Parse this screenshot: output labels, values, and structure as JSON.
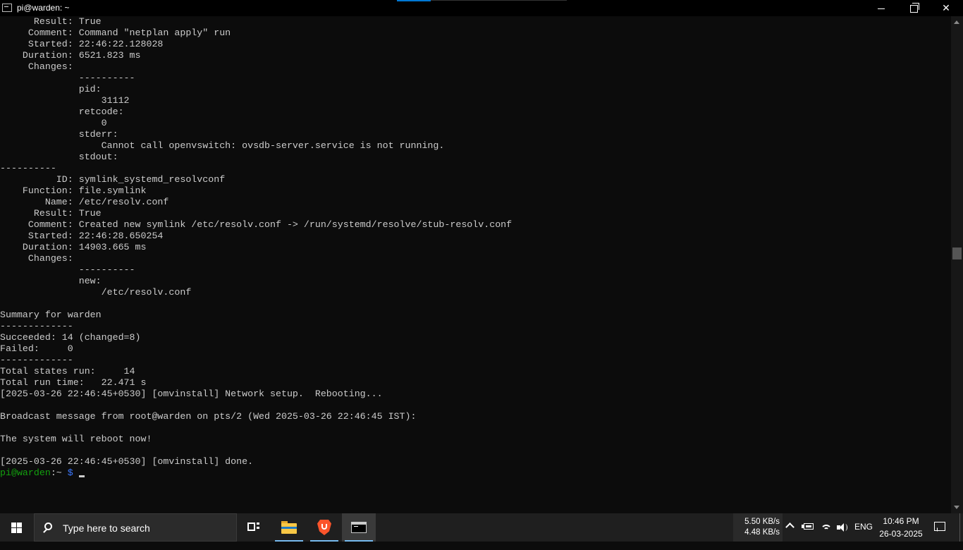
{
  "window": {
    "title": "pi@warden: ~"
  },
  "terminal": {
    "lines": [
      "      Result: True",
      "     Comment: Command \"netplan apply\" run",
      "     Started: 22:46:22.128028",
      "    Duration: 6521.823 ms",
      "     Changes:",
      "              ----------",
      "              pid:",
      "                  31112",
      "              retcode:",
      "                  0",
      "              stderr:",
      "                  Cannot call openvswitch: ovsdb-server.service is not running.",
      "              stdout:",
      "----------",
      "          ID: symlink_systemd_resolvconf",
      "    Function: file.symlink",
      "        Name: /etc/resolv.conf",
      "      Result: True",
      "     Comment: Created new symlink /etc/resolv.conf -> /run/systemd/resolve/stub-resolv.conf",
      "     Started: 22:46:28.650254",
      "    Duration: 14903.665 ms",
      "     Changes:",
      "              ----------",
      "              new:",
      "                  /etc/resolv.conf",
      "",
      "Summary for warden",
      "-------------",
      "Succeeded: 14 (changed=8)",
      "Failed:     0",
      "-------------",
      "Total states run:     14",
      "Total run time:   22.471 s",
      "[2025-03-26 22:46:45+0530] [omvinstall] Network setup.  Rebooting...",
      "",
      "Broadcast message from root@warden on pts/2 (Wed 2025-03-26 22:46:45 IST):",
      "",
      "The system will reboot now!",
      "",
      "[2025-03-26 22:46:45+0530] [omvinstall] done."
    ],
    "prompt_user": "pi@warden",
    "prompt_path": ":~",
    "prompt_symbol": " $",
    "colors": {
      "text": "#cccccc",
      "background": "#0c0c0c",
      "prompt_user": "#13a10e",
      "prompt_path": "#3b78ff"
    }
  },
  "taskbar": {
    "search_placeholder": "Type here to search",
    "net_upload": "5.50 KB/s",
    "net_download": "4.48 KB/s",
    "language": "ENG",
    "time": "10:46 PM",
    "date": "26-03-2025",
    "icons": [
      "start-icon",
      "search-icon",
      "task-view-icon",
      "file-explorer-icon",
      "brave-browser-icon",
      "terminal-icon",
      "chevron-up-icon",
      "battery-icon",
      "wifi-icon",
      "volume-icon",
      "notification-icon"
    ]
  }
}
